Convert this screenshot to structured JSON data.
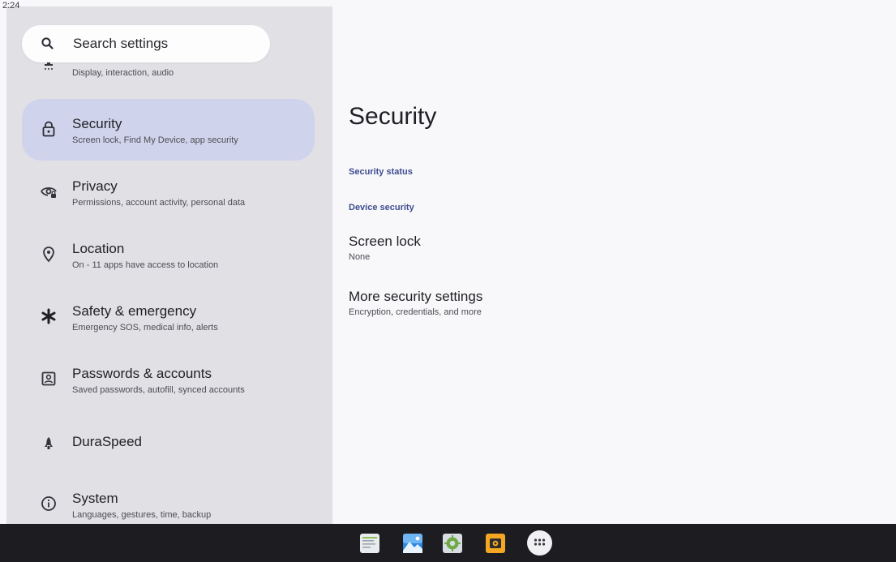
{
  "status_bar": {
    "time": "2:24"
  },
  "search": {
    "placeholder": "Search settings"
  },
  "sidebar": {
    "items": [
      {
        "id": "accessibility",
        "title": "",
        "subtitle": "Display, interaction, audio",
        "icon": "accessibility-icon"
      },
      {
        "id": "security",
        "title": "Security",
        "subtitle": "Screen lock, Find My Device, app security",
        "icon": "lock-icon",
        "selected": true
      },
      {
        "id": "privacy",
        "title": "Privacy",
        "subtitle": "Permissions, account activity, personal data",
        "icon": "privacy-eye-icon"
      },
      {
        "id": "location",
        "title": "Location",
        "subtitle": "On - 11 apps have access to location",
        "icon": "location-pin-icon"
      },
      {
        "id": "safety",
        "title": "Safety & emergency",
        "subtitle": "Emergency SOS, medical info, alerts",
        "icon": "asterisk-icon"
      },
      {
        "id": "passwords",
        "title": "Passwords & accounts",
        "subtitle": "Saved passwords, autofill, synced accounts",
        "icon": "account-box-icon"
      },
      {
        "id": "duraspeed",
        "title": "DuraSpeed",
        "subtitle": "",
        "icon": "rocket-icon"
      },
      {
        "id": "system",
        "title": "System",
        "subtitle": "Languages, gestures, time, backup",
        "icon": "info-icon"
      }
    ]
  },
  "main": {
    "title": "Security",
    "sections": [
      {
        "label": "Security status"
      },
      {
        "label": "Device security"
      }
    ],
    "prefs": [
      {
        "title": "Screen lock",
        "subtitle": "None"
      },
      {
        "title": "More security settings",
        "subtitle": "Encryption, credentials, and more"
      }
    ]
  },
  "taskbar": {
    "apps": [
      "notes-app-icon",
      "gallery-app-icon",
      "android-settings-app-icon",
      "camera-app-icon"
    ],
    "drawer": "app-drawer-icon"
  },
  "colors": {
    "sidebar_bg": "#e0e0e5",
    "selected_bg": "#cfd4ec",
    "accent_text": "#3f4d8f",
    "taskbar_bg": "#1d1d21"
  }
}
